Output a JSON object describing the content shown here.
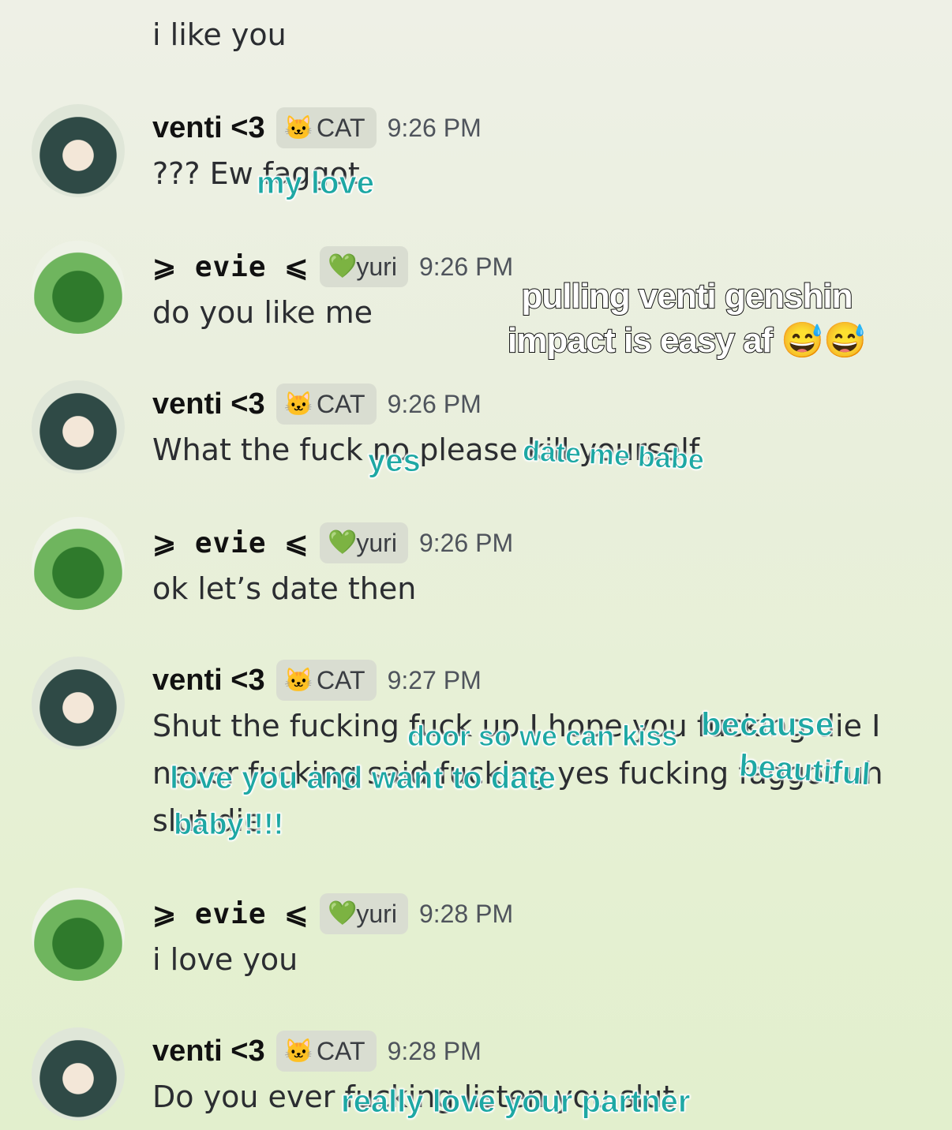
{
  "top_message": "i like you",
  "messages": [
    {
      "user": "venti <3",
      "tag_icon": "🐱",
      "tag": "CAT",
      "time": "9:26 PM",
      "lines": [
        "??? Ew faggot"
      ]
    },
    {
      "user": "⩾ evie ⩽",
      "tag_icon": "💚",
      "tag": "yuri",
      "time": "9:26 PM",
      "lines": [
        "do you like me"
      ]
    },
    {
      "user": "venti <3",
      "tag_icon": "🐱",
      "tag": "CAT",
      "time": "9:26 PM",
      "lines": [
        "What the fuck no please kill yourself"
      ]
    },
    {
      "user": "⩾ evie ⩽",
      "tag_icon": "💚",
      "tag": "yuri",
      "time": "9:26 PM",
      "lines": [
        "ok let’s date then"
      ]
    },
    {
      "user": "venti <3",
      "tag_icon": "🐱",
      "tag": "CAT",
      "time": "9:27 PM",
      "lines": [
        "Shut the fucking fuck up I hope you fucking die I",
        "never fucking said fucking yes fucking faggot uh",
        "slut die"
      ]
    },
    {
      "user": "⩾ evie ⩽",
      "tag_icon": "💚",
      "tag": "yuri",
      "time": "9:28 PM",
      "lines": [
        "i love you"
      ]
    },
    {
      "user": "venti <3",
      "tag_icon": "🐱",
      "tag": "CAT",
      "time": "9:28 PM",
      "lines": [
        "Do you ever fucking listen you slut"
      ]
    }
  ],
  "overlays": {
    "my_love": "my love",
    "yes": "yes",
    "date_me": "date me babe",
    "door": "door so we can kiss",
    "because": "because",
    "love_you": "love you and want to date",
    "beautiful": "beautiful",
    "baby": "baby!!!!",
    "partner": "really love your partner"
  },
  "caption": "pulling venti genshin impact is easy af 😅😅",
  "colors": {
    "overlay_text": "#1ea8a4",
    "background": "#e6f0d4"
  }
}
